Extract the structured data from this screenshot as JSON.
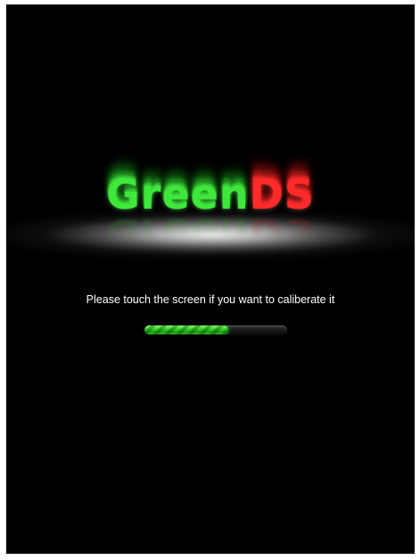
{
  "app": {
    "logo": {
      "part_green": "Green",
      "part_red": "DS"
    },
    "message": "Please touch the screen if you want to caliberate it",
    "progress": {
      "fraction": 0.59,
      "fill_color": "#37d22a",
      "track_color": "#1a1a1a"
    },
    "colors": {
      "background": "#000000",
      "logo_green": "#3ee83b",
      "logo_red": "#ff2b2b"
    }
  }
}
